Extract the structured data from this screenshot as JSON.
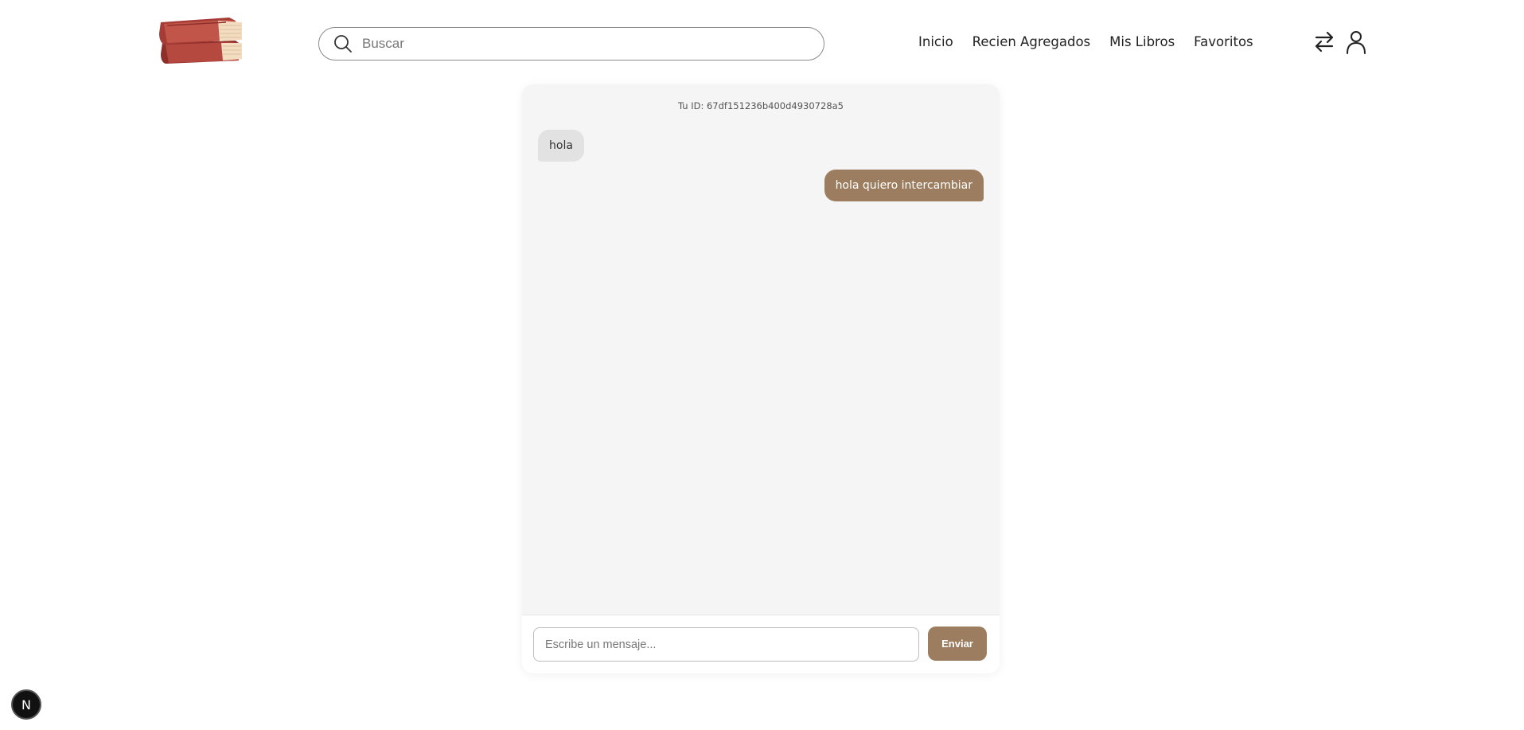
{
  "header": {
    "search": {
      "placeholder": "Buscar",
      "value": ""
    },
    "nav": [
      {
        "label": "Inicio"
      },
      {
        "label": "Recien Agregados"
      },
      {
        "label": "Mis Libros"
      },
      {
        "label": "Favoritos"
      }
    ],
    "icons": [
      "books-logo-icon",
      "search-icon",
      "exchange-icon",
      "user-icon"
    ]
  },
  "chat": {
    "user_id": "Tu ID: 67df151236b400d4930728a5",
    "messages": [
      {
        "direction": "received",
        "text": "hola"
      },
      {
        "direction": "sent",
        "text": "hola quiero intercambiar"
      }
    ],
    "input": {
      "placeholder": "Escribe un mensaje...",
      "value": ""
    },
    "send_label": "Enviar"
  },
  "badge": {
    "label": "N"
  },
  "colors": {
    "accent": "#9c7d5f",
    "received_bubble": "#e2e2e2",
    "chat_background": "#f5f5f5",
    "logo_red": "#b5483f",
    "logo_pages": "#f3dcc0"
  }
}
